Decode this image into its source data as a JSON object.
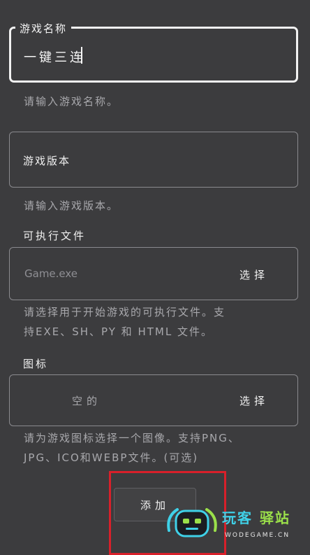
{
  "name_field": {
    "label": "游戏名称",
    "value": "一键三连",
    "helper": "请输入游戏名称。"
  },
  "version_field": {
    "placeholder": "游戏版本",
    "helper": "请输入游戏版本。"
  },
  "executable": {
    "section_label": "可执行文件",
    "placeholder": "Game.exe",
    "select_label": "选择",
    "helper_line1": "请选择用于开始游戏的可执行文件。支",
    "helper_line2": "持EXE、SH、PY 和 HTML 文件。"
  },
  "icon": {
    "section_label": "图标",
    "empty_text": "空的",
    "select_label": "选择",
    "helper_line1": "请为游戏图标选择一个图像。支持PNG、",
    "helper_line2": "JPG、ICO和WEBP文件。(可选)"
  },
  "add_button": {
    "label": "添加"
  },
  "watermark": {
    "brand_part1": "玩客",
    "brand_part2": "驿站",
    "url": "WODEGAME.CN"
  },
  "colors": {
    "background": "#3c3c3e",
    "highlight_frame": "#d8202a",
    "watermark_cyan": "#3fd1e8",
    "watermark_green": "#9be04a"
  }
}
